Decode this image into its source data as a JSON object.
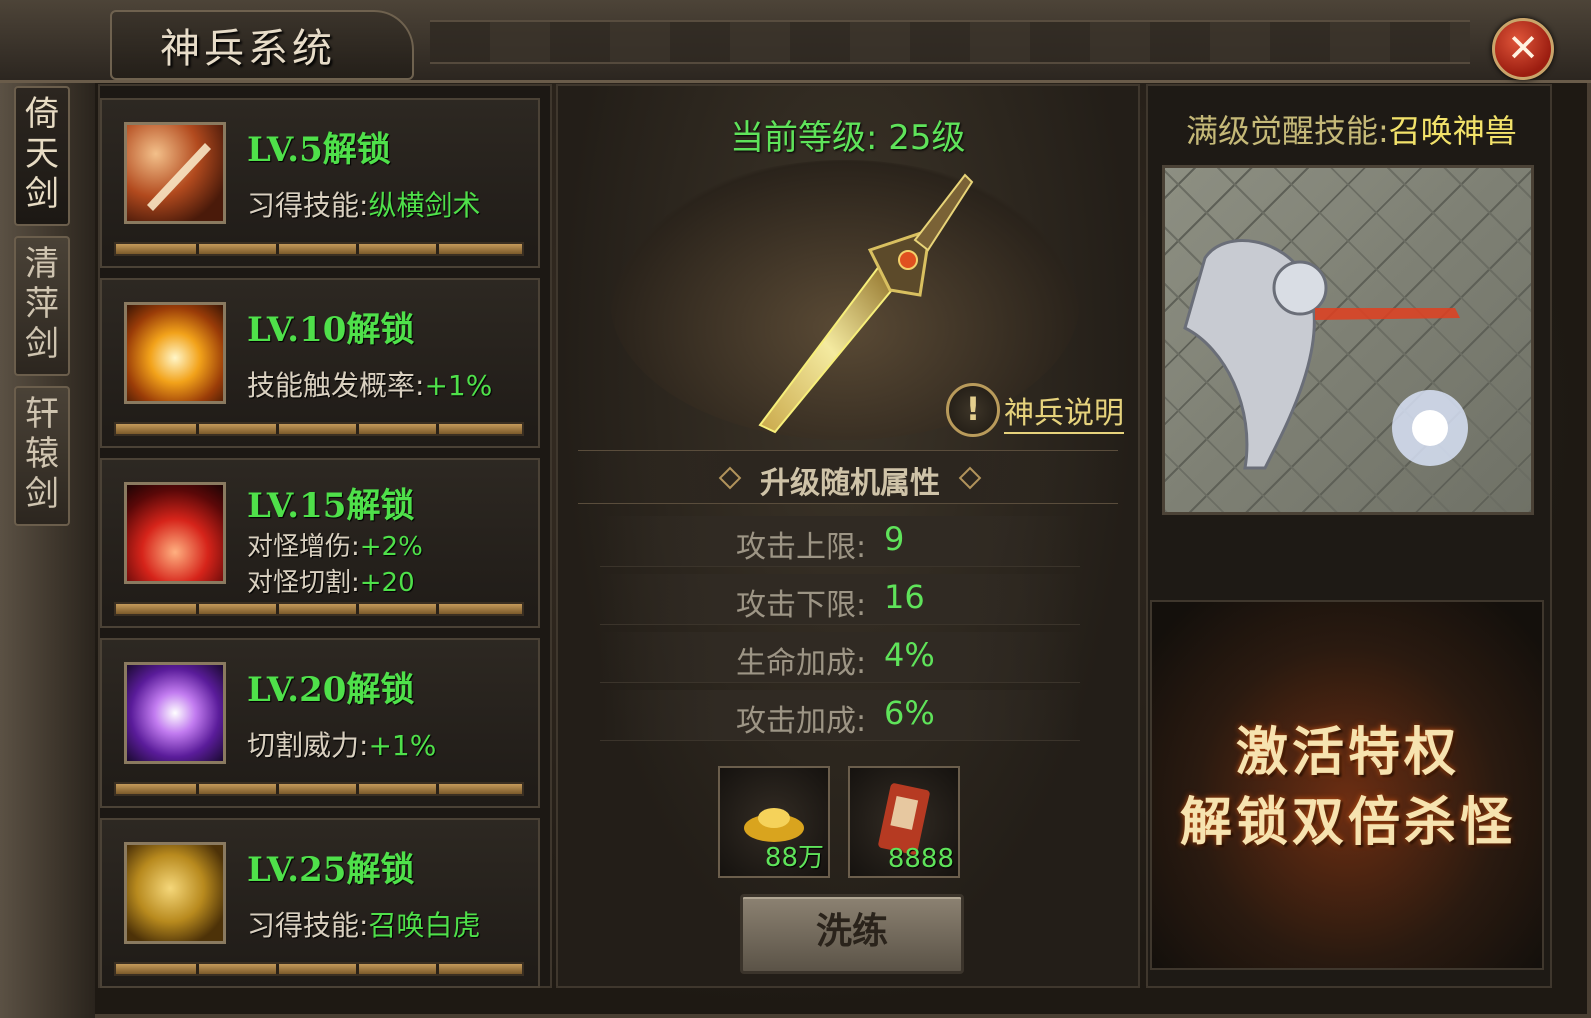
{
  "window": {
    "title": "神兵系统"
  },
  "tabs": [
    {
      "label": "倚天剑",
      "chars": [
        "倚",
        "天",
        "剑"
      ],
      "active": true
    },
    {
      "label": "清萍剑",
      "chars": [
        "清",
        "萍",
        "剑"
      ],
      "active": false
    },
    {
      "label": "轩辕剑",
      "chars": [
        "轩",
        "辕",
        "剑"
      ],
      "active": false
    }
  ],
  "unlocks": [
    {
      "title": "LV.5解锁",
      "lines": [
        {
          "label": "习得技能:",
          "value": "纵横剑术"
        }
      ],
      "icon": "sword-slash-icon"
    },
    {
      "title": "LV.10解锁",
      "lines": [
        {
          "label": "技能触发概率:",
          "value": "+1%"
        }
      ],
      "icon": "fire-vortex-icon"
    },
    {
      "title": "LV.15解锁",
      "lines": [
        {
          "label": "对怪增伤:",
          "value": "+2%"
        },
        {
          "label": "对怪切割:",
          "value": "+20"
        }
      ],
      "icon": "red-burst-icon"
    },
    {
      "title": "LV.20解锁",
      "lines": [
        {
          "label": "切割威力:",
          "value": "+1%"
        }
      ],
      "icon": "purple-lightning-icon"
    },
    {
      "title": "LV.25解锁",
      "lines": [
        {
          "label": "习得技能:",
          "value": "召唤白虎"
        }
      ],
      "icon": "golden-tiger-icon"
    }
  ],
  "center": {
    "level_label": "当前等级: ",
    "level_value": "25级",
    "help_link": "神兵说明",
    "random_title": "升级随机属性",
    "attributes": [
      {
        "label": "攻击上限: ",
        "value": "9"
      },
      {
        "label": "攻击下限: ",
        "value": "16"
      },
      {
        "label": "生命加成: ",
        "value": "4%"
      },
      {
        "label": "攻击加成: ",
        "value": "6%"
      }
    ],
    "costs": [
      {
        "item": "gold-ingot-icon",
        "count": "88万"
      },
      {
        "item": "scroll-icon",
        "count": "8888"
      }
    ],
    "wash_button": "洗练"
  },
  "right": {
    "awaken_label": "满级觉醒技能:",
    "awaken_value": "召唤神兽",
    "promo_line1": "激活特权",
    "promo_line2": "解锁双倍杀怪"
  }
}
